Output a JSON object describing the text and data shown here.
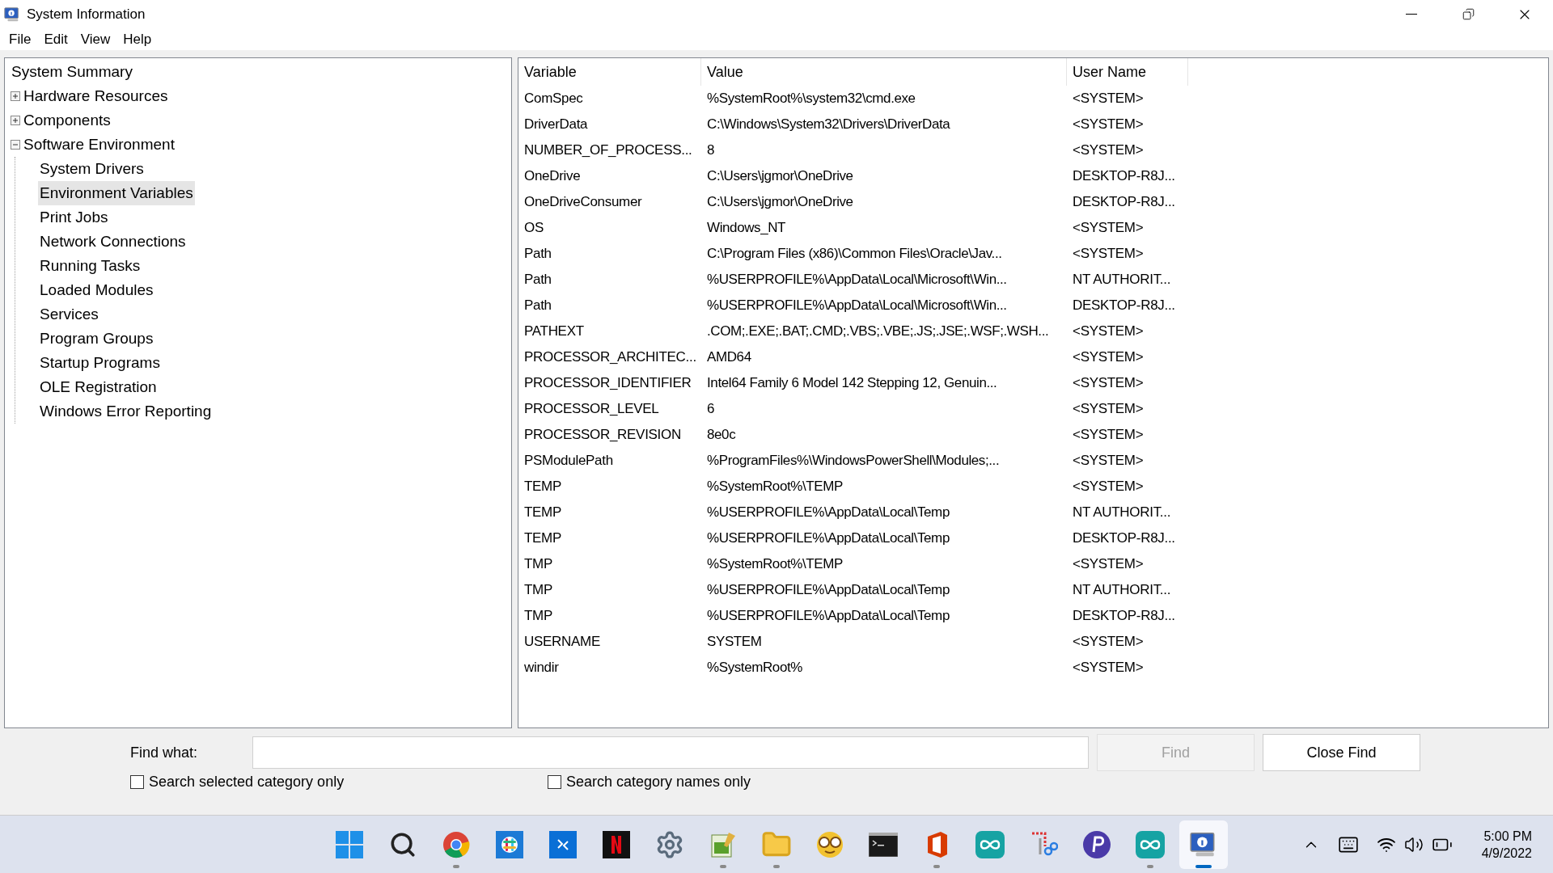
{
  "window": {
    "title": "System Information"
  },
  "menu": [
    "File",
    "Edit",
    "View",
    "Help"
  ],
  "tree": [
    {
      "label": "System Summary",
      "selected": false,
      "children": [
        {
          "label": "Hardware Resources",
          "expanded": false,
          "selected": false
        },
        {
          "label": "Components",
          "expanded": false,
          "selected": false
        },
        {
          "label": "Software Environment",
          "expanded": true,
          "selected": false,
          "children": [
            {
              "label": "System Drivers",
              "selected": false
            },
            {
              "label": "Environment Variables",
              "selected": true
            },
            {
              "label": "Print Jobs",
              "selected": false
            },
            {
              "label": "Network Connections",
              "selected": false
            },
            {
              "label": "Running Tasks",
              "selected": false
            },
            {
              "label": "Loaded Modules",
              "selected": false
            },
            {
              "label": "Services",
              "selected": false
            },
            {
              "label": "Program Groups",
              "selected": false
            },
            {
              "label": "Startup Programs",
              "selected": false
            },
            {
              "label": "OLE Registration",
              "selected": false
            },
            {
              "label": "Windows Error Reporting",
              "selected": false
            }
          ]
        }
      ]
    }
  ],
  "table": {
    "columns": [
      "Variable",
      "Value",
      "User Name"
    ],
    "rows": [
      [
        "ComSpec",
        "%SystemRoot%\\system32\\cmd.exe",
        "<SYSTEM>"
      ],
      [
        "DriverData",
        "C:\\Windows\\System32\\Drivers\\DriverData",
        "<SYSTEM>"
      ],
      [
        "NUMBER_OF_PROCESS...",
        "8",
        "<SYSTEM>"
      ],
      [
        "OneDrive",
        "C:\\Users\\jgmor\\OneDrive",
        "DESKTOP-R8J..."
      ],
      [
        "OneDriveConsumer",
        "C:\\Users\\jgmor\\OneDrive",
        "DESKTOP-R8J..."
      ],
      [
        "OS",
        "Windows_NT",
        "<SYSTEM>"
      ],
      [
        "Path",
        "C:\\Program Files (x86)\\Common Files\\Oracle\\Jav...",
        "<SYSTEM>"
      ],
      [
        "Path",
        "%USERPROFILE%\\AppData\\Local\\Microsoft\\Win...",
        "NT AUTHORIT..."
      ],
      [
        "Path",
        "%USERPROFILE%\\AppData\\Local\\Microsoft\\Win...",
        "DESKTOP-R8J..."
      ],
      [
        "PATHEXT",
        ".COM;.EXE;.BAT;.CMD;.VBS;.VBE;.JS;.JSE;.WSF;.WSH...",
        "<SYSTEM>"
      ],
      [
        "PROCESSOR_ARCHITEC...",
        "AMD64",
        "<SYSTEM>"
      ],
      [
        "PROCESSOR_IDENTIFIER",
        "Intel64 Family 6 Model 142 Stepping 12, Genuin...",
        "<SYSTEM>"
      ],
      [
        "PROCESSOR_LEVEL",
        "6",
        "<SYSTEM>"
      ],
      [
        "PROCESSOR_REVISION",
        "8e0c",
        "<SYSTEM>"
      ],
      [
        "PSModulePath",
        "%ProgramFiles%\\WindowsPowerShell\\Modules;...",
        "<SYSTEM>"
      ],
      [
        "TEMP",
        "%SystemRoot%\\TEMP",
        "<SYSTEM>"
      ],
      [
        "TEMP",
        "%USERPROFILE%\\AppData\\Local\\Temp",
        "NT AUTHORIT..."
      ],
      [
        "TEMP",
        "%USERPROFILE%\\AppData\\Local\\Temp",
        "DESKTOP-R8J..."
      ],
      [
        "TMP",
        "%SystemRoot%\\TEMP",
        "<SYSTEM>"
      ],
      [
        "TMP",
        "%USERPROFILE%\\AppData\\Local\\Temp",
        "NT AUTHORIT..."
      ],
      [
        "TMP",
        "%USERPROFILE%\\AppData\\Local\\Temp",
        "DESKTOP-R8J..."
      ],
      [
        "USERNAME",
        "SYSTEM",
        "<SYSTEM>"
      ],
      [
        "windir",
        "%SystemRoot%",
        "<SYSTEM>"
      ]
    ]
  },
  "find": {
    "label": "Find what:",
    "find_button": {
      "label": "Find",
      "disabled": true
    },
    "close_button": {
      "label": "Close Find",
      "disabled": false
    },
    "options": [
      {
        "label": "Search selected category only",
        "checked": false
      },
      {
        "label": "Search category names only",
        "checked": false
      }
    ]
  },
  "taskbar": {
    "apps": [
      {
        "kind": "start",
        "running": false,
        "active": false
      },
      {
        "kind": "search",
        "running": false,
        "active": false
      },
      {
        "kind": "chrome",
        "running": true,
        "active": false
      },
      {
        "kind": "slack",
        "running": false,
        "active": false
      },
      {
        "kind": "remote",
        "running": false,
        "active": false
      },
      {
        "kind": "netflix",
        "running": false,
        "active": false
      },
      {
        "kind": "settings",
        "running": false,
        "active": false
      },
      {
        "kind": "editor",
        "running": true,
        "active": false
      },
      {
        "kind": "folder",
        "running": true,
        "active": false
      },
      {
        "kind": "owl",
        "running": false,
        "active": false
      },
      {
        "kind": "terminal",
        "running": false,
        "active": false
      },
      {
        "kind": "office",
        "running": true,
        "active": false
      },
      {
        "kind": "arduino",
        "running": false,
        "active": false
      },
      {
        "kind": "snip",
        "running": false,
        "active": false
      },
      {
        "kind": "pcircle",
        "running": false,
        "active": false
      },
      {
        "kind": "arduino",
        "running": true,
        "active": false
      },
      {
        "kind": "sysinfo",
        "running": true,
        "active": true
      }
    ],
    "time": "5:00 PM",
    "date": "4/9/2022"
  }
}
